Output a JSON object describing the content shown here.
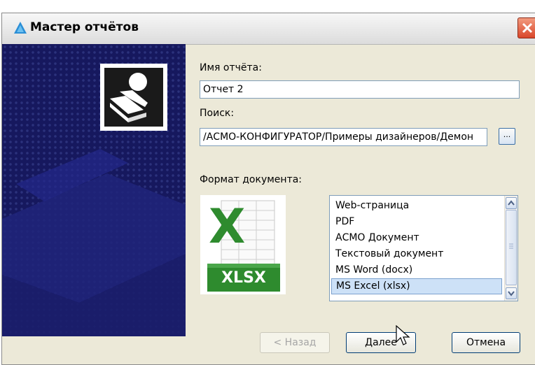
{
  "window": {
    "title": "Мастер отчётов"
  },
  "form": {
    "report_name_label": "Имя отчёта:",
    "report_name_value": "Отчет 2",
    "search_label": "Поиск:",
    "search_path_value": "/АСМО-КОНФИГУРАТОР/Примеры дизайнеров/Демон",
    "browse_label": "...",
    "format_label": "Формат документа:"
  },
  "format_icon": {
    "caption": "XLSX",
    "letter": "X"
  },
  "formats": {
    "items": [
      "Web-страница",
      "PDF",
      "АСМО Документ",
      "Текстовый документ",
      "MS Word (docx)",
      "MS Excel (xlsx)"
    ],
    "selected": "MS Excel (xlsx)"
  },
  "buttons": {
    "back": "< Назад",
    "next": "Далее",
    "cancel": "Отмена"
  },
  "colors": {
    "banner": "#16185e",
    "excel_green": "#2e8b2e",
    "selection": "#cde1f7"
  }
}
